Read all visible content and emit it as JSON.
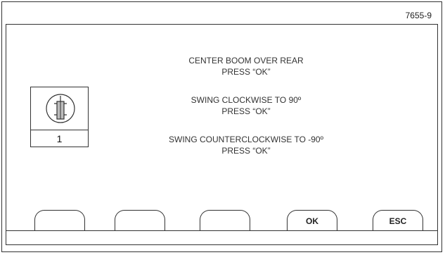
{
  "figure_id": "7655-9",
  "icon": {
    "name": "boom-rotation-icon",
    "number": "1"
  },
  "instructions": [
    {
      "line1": "CENTER BOOM OVER REAR",
      "line2": "PRESS “OK”"
    },
    {
      "line1": "SWING CLOCKWISE TO 90º",
      "line2": "PRESS “OK”"
    },
    {
      "line1": "SWING COUNTERCLOCKWISE TO -90º",
      "line2": "PRESS “OK”"
    }
  ],
  "softkeys": [
    {
      "label": ""
    },
    {
      "label": ""
    },
    {
      "label": ""
    },
    {
      "label": "OK"
    },
    {
      "label": "ESC"
    }
  ]
}
